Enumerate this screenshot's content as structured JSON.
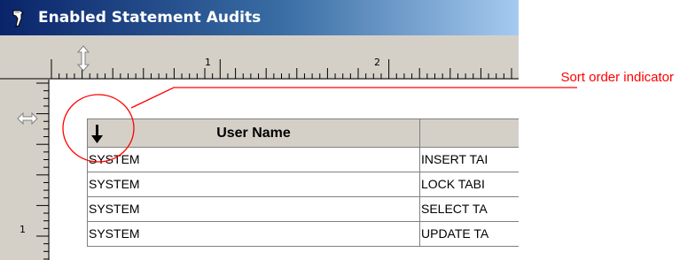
{
  "window": {
    "title": "Enabled Statement Audits",
    "title_icon": "report-icon"
  },
  "ruler": {
    "horizontal_numbers": [
      "1",
      "2"
    ],
    "vertical_numbers": [
      "1"
    ],
    "horizontal_marker_icon": "vertical-resize-icon",
    "vertical_marker_icon": "horizontal-resize-icon"
  },
  "table": {
    "sort_indicator_icon": "sort-descending-arrow-icon",
    "columns": [
      "User Name",
      ""
    ],
    "rows": [
      [
        "SYSTEM",
        "INSERT TAI"
      ],
      [
        "SYSTEM",
        "LOCK TABI"
      ],
      [
        "SYSTEM",
        "SELECT TA"
      ],
      [
        "SYSTEM",
        "UPDATE TA"
      ]
    ]
  },
  "annotation": {
    "label": "Sort order indicator",
    "color": "#ff0000"
  },
  "colors": {
    "titlebar_start": "#0a246a",
    "titlebar_end": "#a6caf0",
    "ruler_background": "#d4d0c8",
    "header_background": "#d4d0c8"
  }
}
